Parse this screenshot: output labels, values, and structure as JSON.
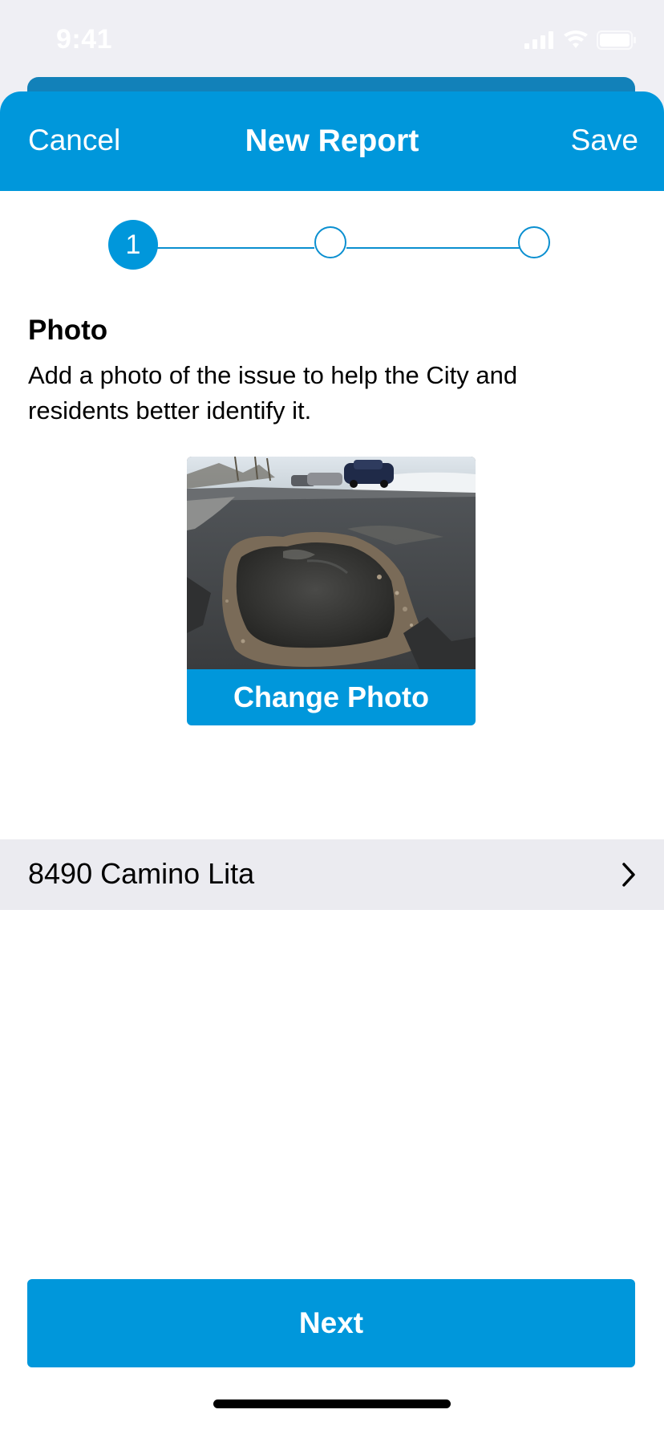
{
  "status_bar": {
    "time": "9:41",
    "icons": [
      "cellular-signal-icon",
      "wifi-icon",
      "battery-icon"
    ]
  },
  "nav": {
    "cancel_label": "Cancel",
    "title": "New Report",
    "save_label": "Save"
  },
  "stepper": {
    "current_step": 1,
    "current_label": "1",
    "total_steps": 3
  },
  "photo_section": {
    "title": "Photo",
    "description": "Add a photo of the issue to help the City and residents better identify it.",
    "photo_subject": "pothole-photo",
    "change_label": "Change Photo"
  },
  "location": {
    "address": "8490 Camino Lita",
    "icon": "chevron-right-icon"
  },
  "next_label": "Next",
  "colors": {
    "accent": "#0097db",
    "background": "#efeff4",
    "row_background": "#ebebf0"
  }
}
